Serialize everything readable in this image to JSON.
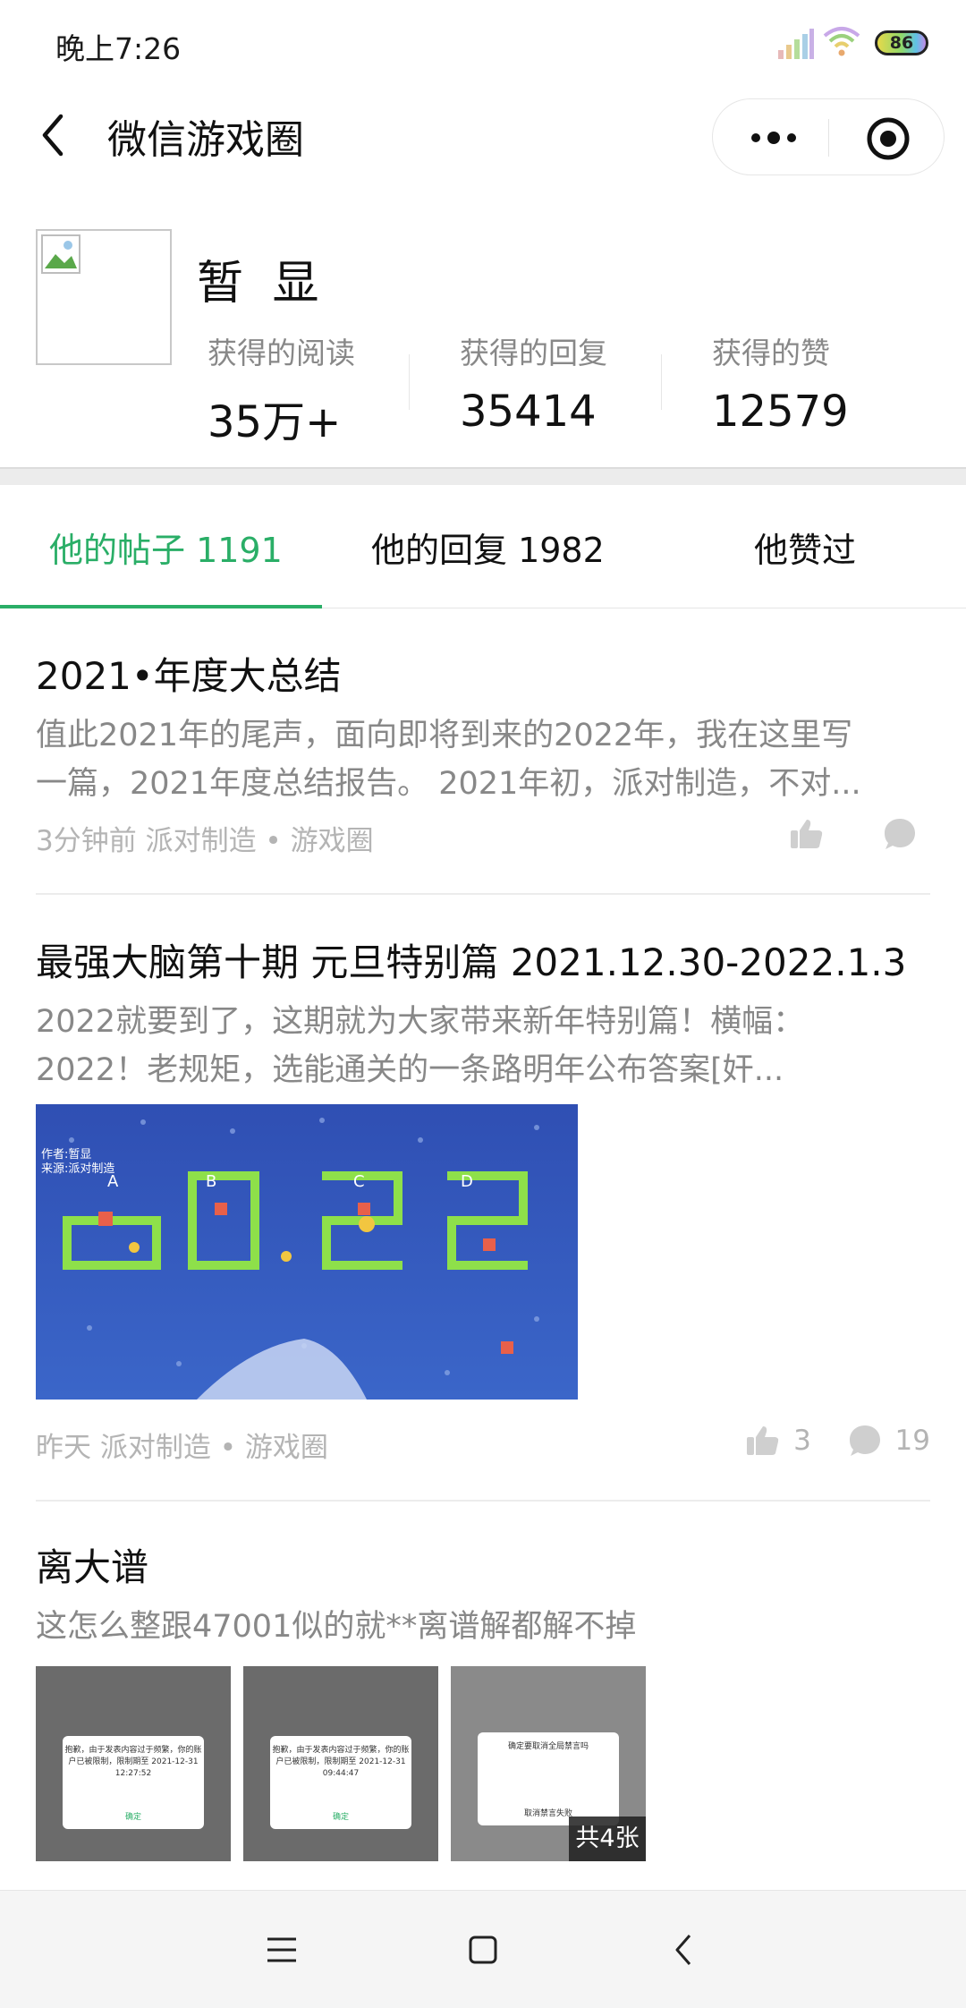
{
  "status_bar": {
    "time": "晚上7:26",
    "battery": "86",
    "icons": [
      "signal-icon",
      "wifi-icon",
      "battery-icon"
    ]
  },
  "nav": {
    "title": "微信游戏圈",
    "back_icon": "chevron-left-icon",
    "more_icon": "more-dots-icon",
    "close_icon": "target-close-icon"
  },
  "profile": {
    "name": "暂 显",
    "stats": [
      {
        "label": "获得的阅读",
        "value": "35万+"
      },
      {
        "label": "获得的回复",
        "value": "35414"
      },
      {
        "label": "获得的赞",
        "value": "12579"
      }
    ]
  },
  "tabs": [
    {
      "label": "他的帖子 1191",
      "active": true
    },
    {
      "label": "他的回复 1982",
      "active": false
    },
    {
      "label": "他赞过",
      "active": false
    }
  ],
  "posts": [
    {
      "title": "2021•年度大总结",
      "body_lines": [
        "值此2021年的尾声，面向即将到来的2022年，我在这里写",
        "一篇，2021年度总结报告。 2021年初，派对制造，不对..."
      ],
      "meta": "3分钟前 派对制造 • 游戏圈",
      "likes": "",
      "comments": ""
    },
    {
      "title": "最强大脑第十期 元旦特别篇 2021.12.30-2022.1.3",
      "body_lines": [
        "2022就要到了，这期就为大家带来新年特别篇！横幅：",
        "2022！老规矩，选能通关的一条路明年公布答案[奸..."
      ],
      "image_caption_lines": [
        "作者:暂显",
        "来源:派对制造"
      ],
      "image_letters": [
        "A",
        "B",
        "C",
        "D"
      ],
      "meta": "昨天 派对制造 • 游戏圈",
      "likes": "3",
      "comments": "19"
    },
    {
      "title": "离大谱",
      "body_lines": [
        "这怎么整跟47001似的就**离谱解都解不掉"
      ],
      "thumbs": [
        {
          "text": "抱歉，由于发表内容过于频繁，你的账户已被限制，限制期至 2021-12-31 12:27:52",
          "ok": "确定"
        },
        {
          "text": "抱歉，由于发表内容过于频繁，你的账户已被限制，限制期至 2021-12-31 09:44:47",
          "ok": "确定"
        },
        {
          "text": "确定要取消全局禁言吗",
          "ok": "取消禁言失败"
        }
      ],
      "more_badge": "共4张"
    }
  ],
  "colors": {
    "accent_green": "#2aae67",
    "muted_text": "#888888",
    "meta_text": "#b4b4b4"
  }
}
